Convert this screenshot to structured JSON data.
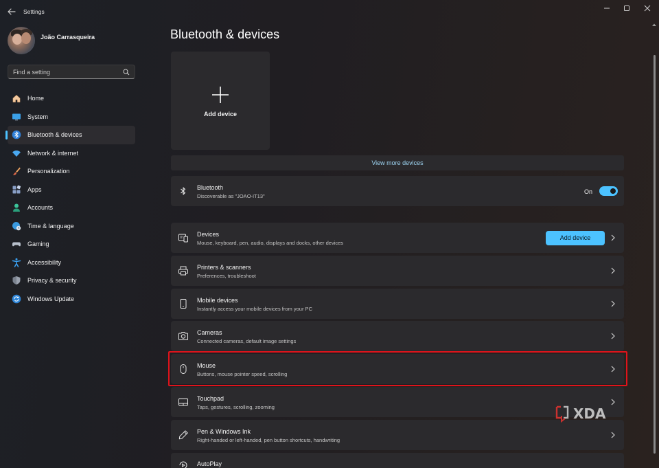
{
  "window": {
    "title": "Settings"
  },
  "user": {
    "name": "João Carrasqueira"
  },
  "search": {
    "placeholder": "Find a setting"
  },
  "sidebar": {
    "items": [
      {
        "label": "Home",
        "icon": "home-icon"
      },
      {
        "label": "System",
        "icon": "monitor-icon"
      },
      {
        "label": "Bluetooth & devices",
        "icon": "bluetooth-icon",
        "active": true
      },
      {
        "label": "Network & internet",
        "icon": "wifi-icon"
      },
      {
        "label": "Personalization",
        "icon": "paintbrush-icon"
      },
      {
        "label": "Apps",
        "icon": "apps-icon"
      },
      {
        "label": "Accounts",
        "icon": "person-icon"
      },
      {
        "label": "Time & language",
        "icon": "globe-clock-icon"
      },
      {
        "label": "Gaming",
        "icon": "gamepad-icon"
      },
      {
        "label": "Accessibility",
        "icon": "accessibility-icon"
      },
      {
        "label": "Privacy & security",
        "icon": "shield-icon"
      },
      {
        "label": "Windows Update",
        "icon": "update-icon"
      }
    ]
  },
  "main": {
    "title": "Bluetooth & devices",
    "add_tile_label": "Add device",
    "view_more": "View more devices",
    "bluetooth": {
      "title": "Bluetooth",
      "subtitle": "Discoverable as \"JOAO-IT13\"",
      "state_label": "On",
      "enabled": true
    },
    "cards": [
      {
        "title": "Devices",
        "subtitle": "Mouse, keyboard, pen, audio, displays and docks, other devices",
        "icon": "devices-icon",
        "button": "Add device"
      },
      {
        "title": "Printers & scanners",
        "subtitle": "Preferences, troubleshoot",
        "icon": "printer-icon"
      },
      {
        "title": "Mobile devices",
        "subtitle": "Instantly access your mobile devices from your PC",
        "icon": "phone-icon"
      },
      {
        "title": "Cameras",
        "subtitle": "Connected cameras, default image settings",
        "icon": "camera-icon"
      },
      {
        "title": "Mouse",
        "subtitle": "Buttons, mouse pointer speed, scrolling",
        "icon": "mouse-icon",
        "highlighted": true
      },
      {
        "title": "Touchpad",
        "subtitle": "Taps, gestures, scrolling, zooming",
        "icon": "touchpad-icon"
      },
      {
        "title": "Pen & Windows Ink",
        "subtitle": "Right-handed or left-handed, pen button shortcuts, handwriting",
        "icon": "pen-icon"
      },
      {
        "title": "AutoPlay",
        "subtitle": "",
        "icon": "autoplay-icon"
      }
    ]
  },
  "watermark": {
    "text": "XDA"
  },
  "colors": {
    "accent": "#4cc2ff",
    "highlight": "#e0131b",
    "card_bg": "#2b2a2d"
  }
}
